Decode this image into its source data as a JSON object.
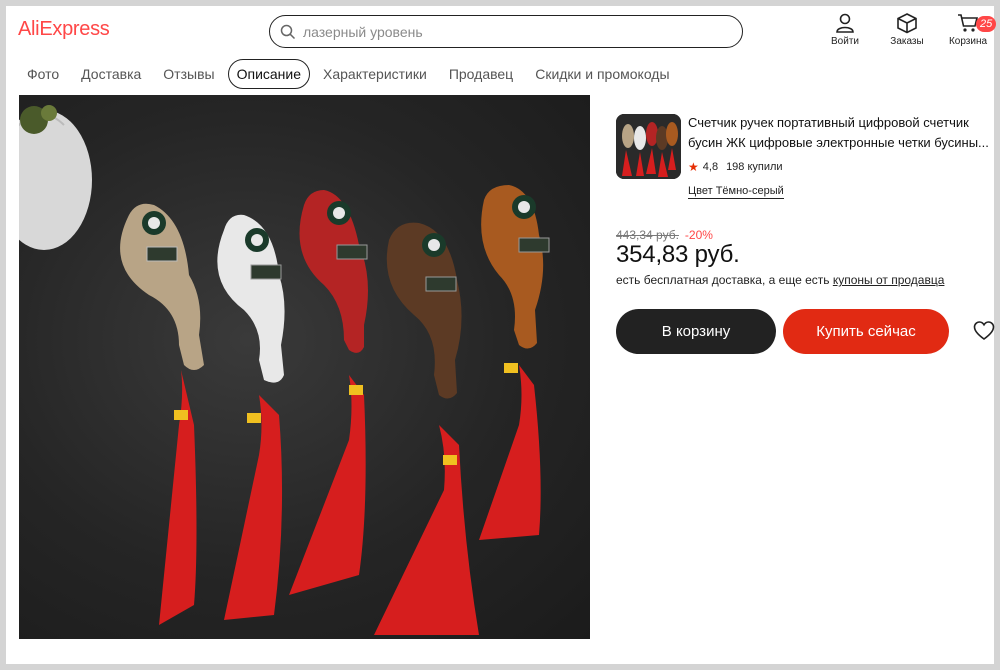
{
  "header": {
    "logo": "AliExpress",
    "search_placeholder": "лазерный уровень",
    "icons": [
      {
        "name": "user-icon",
        "label": "Войти"
      },
      {
        "name": "box-icon",
        "label": "Заказы"
      },
      {
        "name": "cart-icon",
        "label": "Корзина",
        "badge": "25"
      }
    ]
  },
  "tabs": [
    {
      "label": "Фото",
      "active": false
    },
    {
      "label": "Доставка",
      "active": false
    },
    {
      "label": "Отзывы",
      "active": false
    },
    {
      "label": "Описание",
      "active": true
    },
    {
      "label": "Характеристики",
      "active": false
    },
    {
      "label": "Продавец",
      "active": false
    },
    {
      "label": "Скидки и промокоды",
      "active": false
    }
  ],
  "product": {
    "title": "Счетчик ручек портативный цифровой счетчик бусин ЖК цифровые электронные четки бусины...",
    "rating": "4,8",
    "sold": "198 купили",
    "color_label": "Цвет Тёмно-серый",
    "old_price": "443,34 руб.",
    "discount": "-20%",
    "price": "354,83 руб.",
    "shipping_text": "есть бесплатная доставка, а еще есть ",
    "shipping_link": "купоны от продавца",
    "cart_button": "В корзину",
    "buy_button": "Купить сейчас"
  },
  "colors": {
    "brand": "#ff4747",
    "buy": "#e12a13",
    "cart": "#222222"
  }
}
